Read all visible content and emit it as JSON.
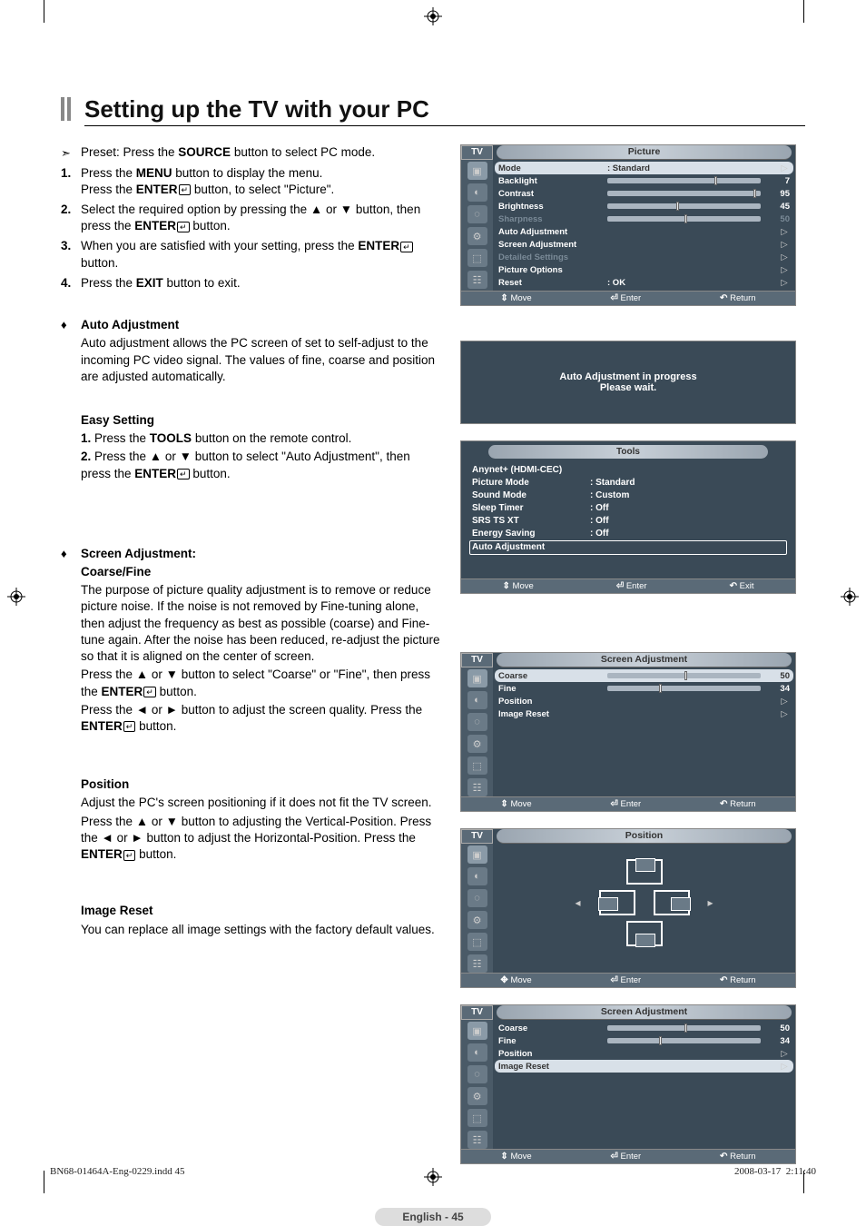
{
  "title": "Setting up the TV with your PC",
  "preset_line": "Preset: Press the SOURCE button to select PC mode.",
  "steps": [
    {
      "num": "1.",
      "text": "Press the MENU button to display the menu. Press the ENTER button, to select \"Picture\"."
    },
    {
      "num": "2.",
      "text": "Select the required option by pressing the ▲ or ▼ button, then press the ENTER button."
    },
    {
      "num": "3.",
      "text": "When you are satisfied with your setting, press the ENTER button."
    },
    {
      "num": "4.",
      "text": "Press the EXIT button to exit."
    }
  ],
  "auto_adj": {
    "title": "Auto Adjustment",
    "para": "Auto adjustment allows the PC screen of set to self-adjust to the incoming PC video signal. The values of fine, coarse and position are adjusted automatically."
  },
  "easy_setting": {
    "title": "Easy Setting",
    "step1": "1. Press the TOOLS button on the remote control.",
    "step2": "2. Press the ▲ or ▼ button to select \"Auto Adjustment\", then press the ENTER button."
  },
  "screen_adj": {
    "title": "Screen Adjustment:",
    "subtitle": "Coarse/Fine",
    "para1": "The purpose of picture quality adjustment is to remove or reduce picture noise. If the noise is not removed by Fine-tuning alone, then adjust the frequency as best as possible (coarse) and Fine-tune again. After the noise has been reduced, re-adjust the picture so that it is aligned on the center of screen.",
    "para2": "Press the ▲ or ▼ button to select \"Coarse\" or \"Fine\", then press the ENTER button.",
    "para3": "Press the ◄ or ► button to adjust the screen quality. Press the ENTER button."
  },
  "position": {
    "title": "Position",
    "para1": "Adjust the PC's screen positioning if it does not fit the TV screen.",
    "para2": "Press the ▲ or ▼ button to adjusting the Vertical-Position. Press the ◄ or ► button to adjust the Horizontal-Position. Press the ENTER button."
  },
  "image_reset": {
    "title": "Image Reset",
    "para": "You can replace all image settings with the factory default values."
  },
  "page_label": "English - 45",
  "footer": {
    "left": "BN68-01464A-Eng-0229.indd   45",
    "right": "2008-03-17   ‎‎ 2:11:40"
  },
  "osd_picture": {
    "tab": "TV",
    "title": "Picture",
    "rows": [
      {
        "label": "Mode",
        "value": ": Standard",
        "sel": true,
        "arrow": true
      },
      {
        "label": "Backlight",
        "slider": 7,
        "max": 10
      },
      {
        "label": "Contrast",
        "slider": 95,
        "max": 100
      },
      {
        "label": "Brightness",
        "slider": 45,
        "max": 100
      },
      {
        "label": "Sharpness",
        "slider": 50,
        "max": 100,
        "dim": true
      },
      {
        "label": "Auto Adjustment",
        "arrow": true
      },
      {
        "label": "Screen Adjustment",
        "arrow": true
      },
      {
        "label": "Detailed Settings",
        "dim": true,
        "arrow": true
      },
      {
        "label": "Picture Options",
        "arrow": true
      },
      {
        "label": "Reset",
        "value": ": OK",
        "arrow": true
      }
    ],
    "footer": [
      "Move",
      "Enter",
      "Return"
    ]
  },
  "osd_auto": {
    "line1": "Auto Adjustment in progress",
    "line2": "Please wait."
  },
  "osd_tools": {
    "title": "Tools",
    "rows": [
      {
        "label": "Anynet+ (HDMI-CEC)",
        "value": ""
      },
      {
        "label": "Picture Mode",
        "value": ": Standard"
      },
      {
        "label": "Sound Mode",
        "value": ": Custom"
      },
      {
        "label": "Sleep Timer",
        "value": ": Off"
      },
      {
        "label": "SRS TS XT",
        "value": ": Off"
      },
      {
        "label": "Energy Saving",
        "value": ": Off"
      },
      {
        "label": "Auto Adjustment",
        "value": "",
        "sel": true
      }
    ],
    "footer": [
      "Move",
      "Enter",
      "Exit"
    ]
  },
  "osd_screen": {
    "tab": "TV",
    "title": "Screen Adjustment",
    "rows": [
      {
        "label": "Coarse",
        "slider": 50,
        "max": 100,
        "sel": true
      },
      {
        "label": "Fine",
        "slider": 34,
        "max": 100
      },
      {
        "label": "Position",
        "arrow": true
      },
      {
        "label": "Image Reset",
        "arrow": true
      }
    ],
    "footer": [
      "Move",
      "Enter",
      "Return"
    ]
  },
  "osd_position": {
    "tab": "TV",
    "title": "Position",
    "footer": [
      "Move",
      "Enter",
      "Return"
    ]
  },
  "osd_screen2": {
    "tab": "TV",
    "title": "Screen Adjustment",
    "rows": [
      {
        "label": "Coarse",
        "slider": 50,
        "max": 100
      },
      {
        "label": "Fine",
        "slider": 34,
        "max": 100
      },
      {
        "label": "Position",
        "arrow": true
      },
      {
        "label": "Image Reset",
        "arrow": true,
        "sel": true
      }
    ],
    "footer": [
      "Move",
      "Enter",
      "Return"
    ]
  }
}
